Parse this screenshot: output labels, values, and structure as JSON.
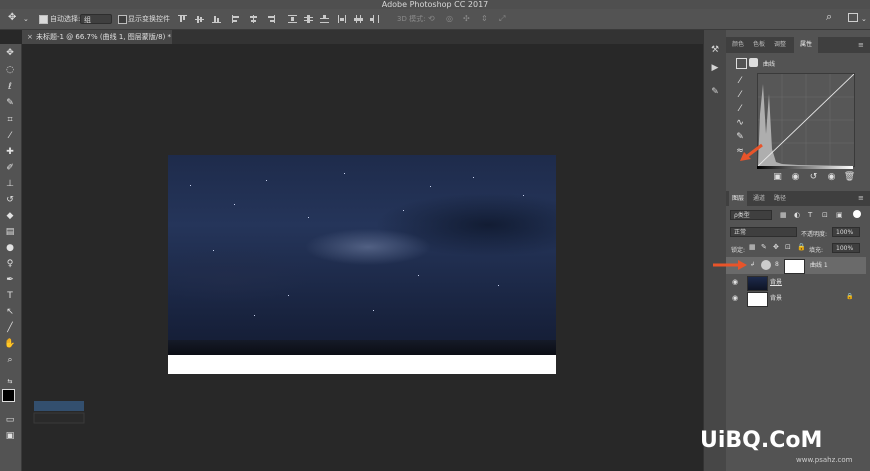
{
  "app": {
    "title": "Adobe Photoshop CC 2017"
  },
  "options_bar": {
    "auto_select_label": "自动选择:",
    "auto_select_value": "组",
    "show_transform_label": "显示变换控件",
    "mode_3d_label": "3D 模式:"
  },
  "document_tab": {
    "title": "未标题-1 @ 66.7% (曲线 1, 图层蒙版/8) *",
    "close": "×"
  },
  "properties_panel": {
    "tabs": [
      "颜色",
      "色板",
      "调整",
      "属性"
    ],
    "active_tab": "属性",
    "adjustment_name": "曲线"
  },
  "layers_panel": {
    "tabs": [
      "图层",
      "通道",
      "路径"
    ],
    "active_tab": "图层",
    "filter_kind": "ρ类型",
    "blend_mode": "正常",
    "opacity_label": "不透明度:",
    "opacity_value": "100%",
    "lock_label": "锁定:",
    "fill_label": "填充:",
    "fill_value": "100%",
    "layers": [
      {
        "name": "曲线 1",
        "selected": true
      },
      {
        "name": "背景",
        "selected": false
      },
      {
        "name": "背景",
        "selected": false,
        "locked": true
      }
    ]
  },
  "watermark": {
    "main": "UiBQ.CoM",
    "sub": "www.psahz.com"
  },
  "colors": {
    "accent_arrow": "#e8542a",
    "panel_bg": "#535353",
    "canvas_bg": "#282828"
  }
}
